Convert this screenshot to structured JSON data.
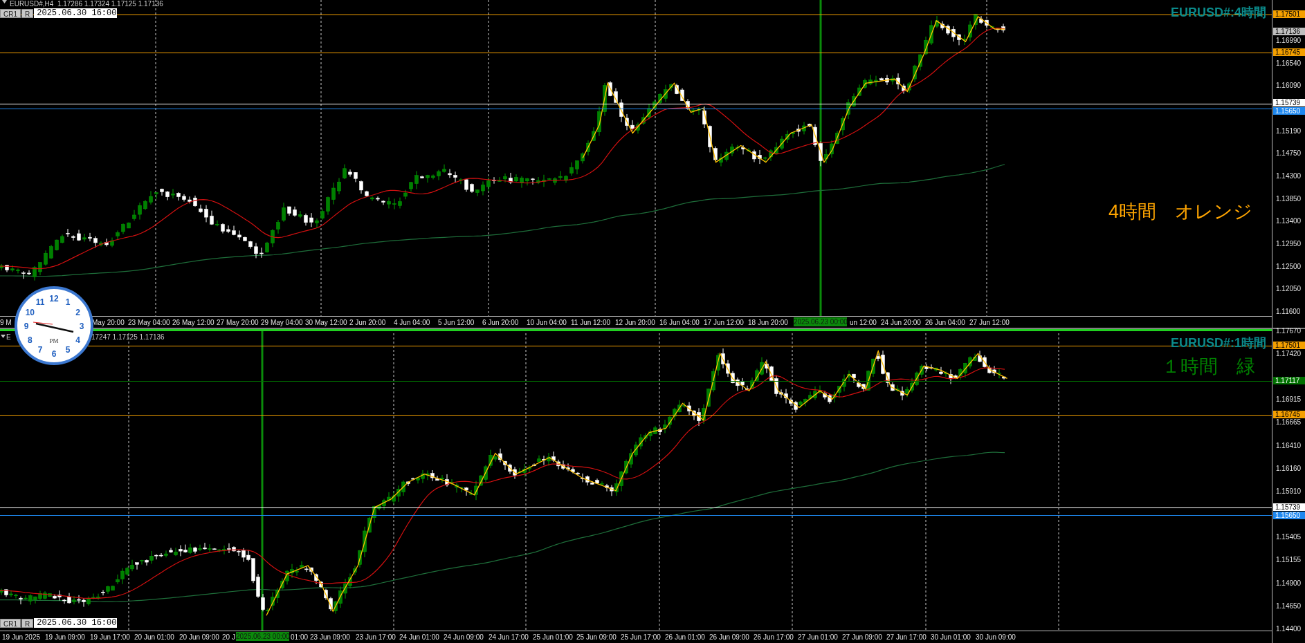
{
  "panes": [
    {
      "header": [
        "EURUSD#,H4  1.17286 1.17324 1.17125 1.17136"
      ],
      "title": "EURUSD#:4時間",
      "note": {
        "text": "4時間　オレンジ",
        "color": "#ffa500"
      },
      "toolbar": {
        "buttons": [
          "CR1",
          "R"
        ],
        "time": "2025.06.30 16:00"
      },
      "price_ticks": [
        "1.16990",
        "1.16540",
        "1.16090",
        "1.15190",
        "1.14750",
        "1.14300",
        "1.13850",
        "1.13400",
        "1.12950",
        "1.12500",
        "1.12050",
        "1.11600"
      ],
      "levels": [
        {
          "price": "1.17501",
          "color": "#f5a000",
          "line": true
        },
        {
          "price": "1.17136",
          "color": "#c0c0c0",
          "line": false
        },
        {
          "price": "1.16745",
          "color": "#f5a000",
          "line": true
        },
        {
          "price": "1.15739",
          "color": "#ffffff",
          "line": true
        },
        {
          "price": "1.15650",
          "color": "#1e88f0",
          "line": true
        }
      ],
      "time_ticks": [
        "9 M",
        "May 20:00",
        "23 May 04:00",
        "26 May 12:00",
        "27 May 20:00",
        "29 May 04:00",
        "30 May 12:00",
        "2 Jun 20:00",
        "4 Jun 04:00",
        "5 Jun 12:00",
        "6 Jun 20:00",
        "10 Jun 04:00",
        "11 Jun 12:00",
        "12 Jun 20:00",
        "16 Jun 04:00",
        "17 Jun 12:00",
        "18 Jun 20:00",
        "un 12:00",
        "24 Jun 20:00",
        "26 Jun 04:00",
        "27 Jun 12:00"
      ],
      "time_marker": "2025.06.23 00:00"
    },
    {
      "header": [
        "E",
        "17247 1.17125 1.17136"
      ],
      "title": "EURUSD#:1時間",
      "note": {
        "text": "１時間　緑",
        "color": "#008000"
      },
      "toolbar": {
        "buttons": [
          "CR1",
          "R"
        ],
        "time": "2025.06.30 16:00"
      },
      "price_ticks": [
        "1.17670",
        "1.17420",
        "1.16915",
        "1.16665",
        "1.16410",
        "1.16160",
        "1.15910",
        "1.15405",
        "1.15155",
        "1.14900",
        "1.14650",
        "1.14400"
      ],
      "levels": [
        {
          "price": "1.17501",
          "color": "#f5a000",
          "line": true
        },
        {
          "price": "1.17117",
          "color": "#007000",
          "line": true
        },
        {
          "price": "1.16745",
          "color": "#f5a000",
          "line": true
        },
        {
          "price": "1.15739",
          "color": "#ffffff",
          "line": true
        },
        {
          "price": "1.15650",
          "color": "#1e88f0",
          "line": true
        }
      ],
      "time_ticks": [
        "19 Jun 2025",
        "19 Jun 09:00",
        "19 Jun 17:00",
        "20 Jun 01:00",
        "20 Jun 09:00",
        "20 J",
        "01:00",
        "23 Jun 09:00",
        "23 Jun 17:00",
        "24 Jun 01:00",
        "24 Jun 09:00",
        "24 Jun 17:00",
        "25 Jun 01:00",
        "25 Jun 09:00",
        "25 Jun 17:00",
        "26 Jun 01:00",
        "26 Jun 09:00",
        "26 Jun 17:00",
        "27 Jun 01:00",
        "27 Jun 09:00",
        "27 Jun 17:00",
        "30 Jun 01:00",
        "30 Jun 09:00"
      ],
      "time_marker": "2025.06.23 00:00"
    }
  ],
  "clock": {
    "numerals": [
      "12",
      "11",
      "1",
      "10",
      "2",
      "9",
      "3",
      "8",
      "4",
      "7",
      "5",
      "6"
    ],
    "period": "PM"
  }
}
